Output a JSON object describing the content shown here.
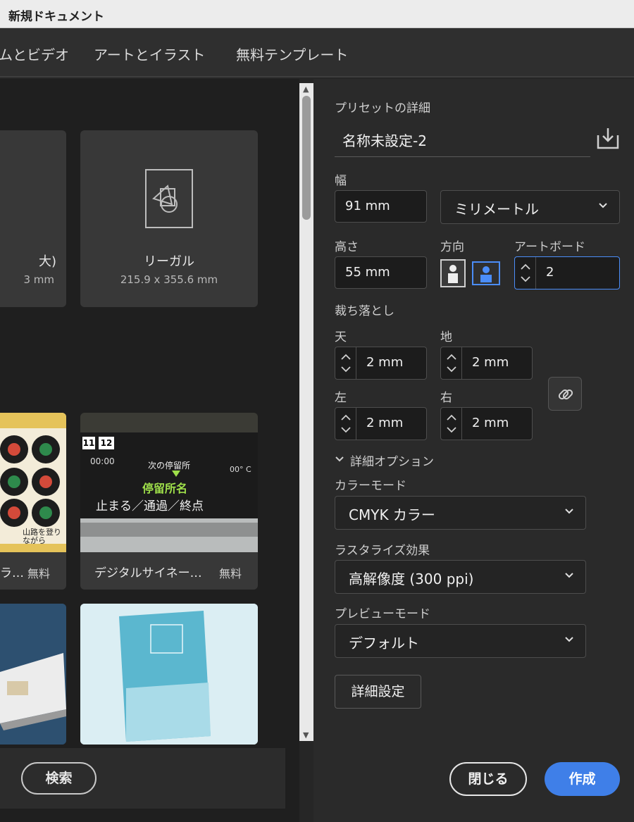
{
  "window": {
    "title": "新規ドキュメント"
  },
  "tabs": [
    {
      "label": "ムとビデオ"
    },
    {
      "label": "アートとイラスト"
    },
    {
      "label": "無料テンプレート"
    }
  ],
  "presets": [
    {
      "name": "大)",
      "size": "3 mm"
    },
    {
      "name": "リーガル",
      "size": "215.9 x 355.6 mm"
    }
  ],
  "templates": [
    {
      "label": "ラ…",
      "price": "無料",
      "thumb_text": "山路を登りながら"
    },
    {
      "label": "デジタルサイネー…",
      "price": "無料",
      "sign": {
        "num1": "11",
        "num2": "12",
        "time": "00:00",
        "next": "次の停留所",
        "stop": "停留所名",
        "temp": "00° C",
        "bottom": "止まる／通過／終点"
      }
    },
    {
      "label": "",
      "price": ""
    },
    {
      "label": "",
      "price": ""
    }
  ],
  "search": {
    "label": "検索"
  },
  "details": {
    "section_title": "プリセットの詳細",
    "preset_name": "名称未設定-2",
    "width_label": "幅",
    "width_value": "91 mm",
    "unit": "ミリメートル",
    "height_label": "高さ",
    "height_value": "55 mm",
    "orientation_label": "方向",
    "artboards_label": "アートボード",
    "artboards_value": "2",
    "bleed_label": "裁ち落とし",
    "bleed": {
      "top_label": "天",
      "top": "2 mm",
      "bottom_label": "地",
      "bottom": "2 mm",
      "left_label": "左",
      "left": "2 mm",
      "right_label": "右",
      "right": "2 mm"
    },
    "advanced_options_label": "詳細オプション",
    "color_mode_label": "カラーモード",
    "color_mode": "CMYK カラー",
    "raster_label": "ラスタライズ効果",
    "raster": "高解像度 (300 ppi)",
    "preview_label": "プレビューモード",
    "preview": "デフォルト",
    "advanced_settings": "詳細設定"
  },
  "actions": {
    "close": "閉じる",
    "create": "作成"
  },
  "colors": {
    "accent": "#3f7fe8",
    "focus": "#4b8df8"
  }
}
